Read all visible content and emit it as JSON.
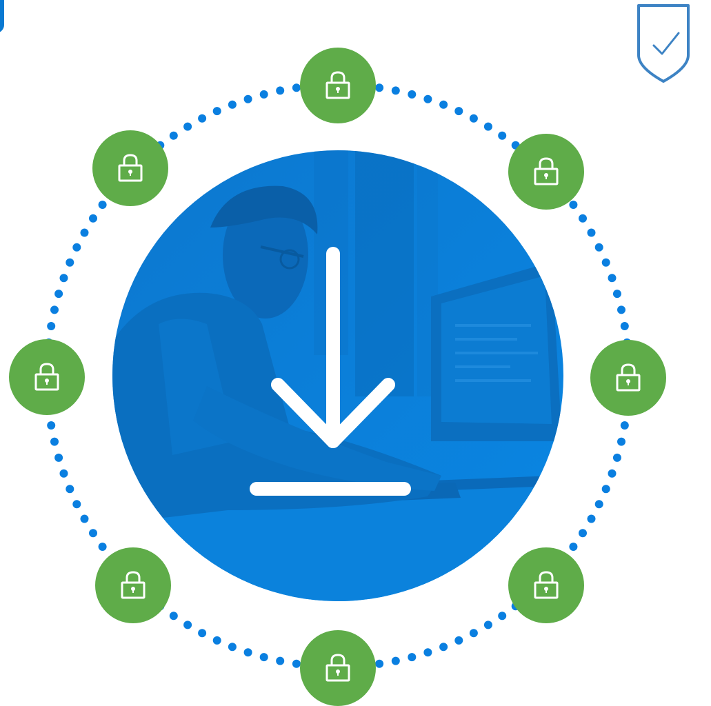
{
  "colors": {
    "ring_dots": "#0a7fe0",
    "central_circle": "#0a82dd",
    "central_shadow": "#085fa8",
    "lock_node": "#5fac49",
    "lock_glyph": "#ffffff",
    "shield_stroke": "#3d83c4",
    "download_arrow": "#ffffff"
  },
  "icons": {
    "shield": "shield-check-icon",
    "center": "download-icon",
    "nodes": "padlock-icon"
  },
  "scene": {
    "photo_description_visible": false,
    "lock_node_count": 8
  }
}
